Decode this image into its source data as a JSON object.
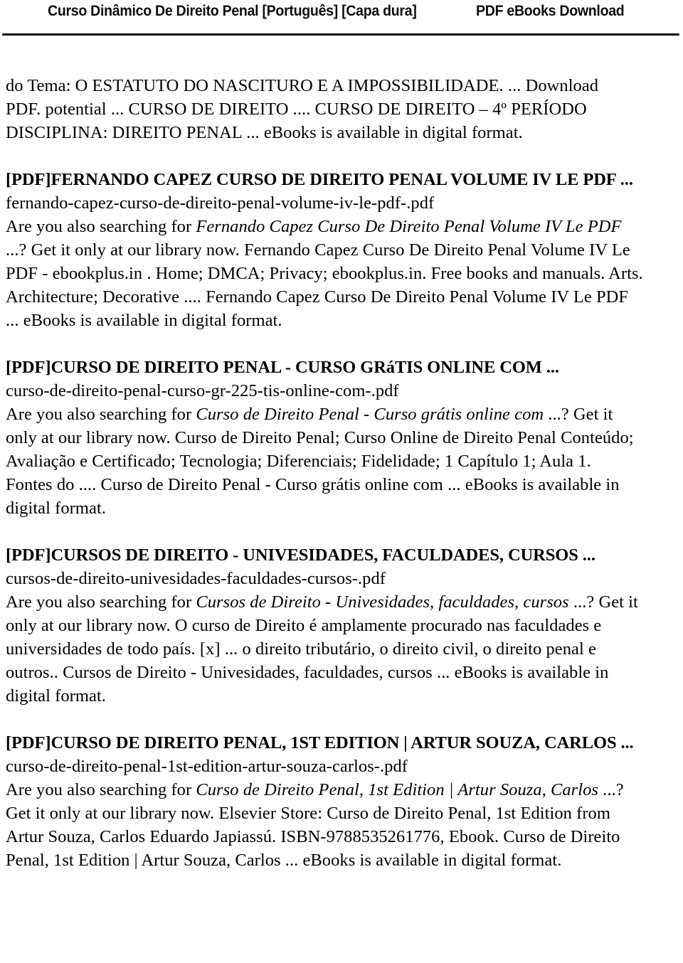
{
  "header": {
    "title": "Curso Dinâmico De Direito Penal [Português]  [Capa dura]",
    "right_label": "PDF eBooks Download"
  },
  "document": {
    "blocks": [
      {
        "name": "intro-paragraph",
        "type": "paragraph",
        "lines": [
          [
            {
              "style": "normal",
              "text": "do Tema: O ESTATUTO DO NASCITURO E A IMPOSSIBILIDADE. ... Download"
            }
          ],
          [
            {
              "style": "normal",
              "text": "PDF. potential ... CURSO DE DIREITO .... CURSO DE DIREITO – 4º PERÍODO"
            }
          ],
          [
            {
              "style": "normal",
              "text": "DISCIPLINA: DIREITO PENAL ... eBooks is available in digital format."
            }
          ]
        ]
      },
      {
        "name": "entry-fernando-capez",
        "type": "entry",
        "heading": "[PDF]FERNANDO CAPEZ CURSO DE DIREITO PENAL VOLUME IV LE PDF ...",
        "filename": "fernando-capez-curso-de-direito-penal-volume-iv-le-pdf-.pdf",
        "lines": [
          [
            {
              "style": "normal",
              "text": "Are you also searching for "
            },
            {
              "style": "italic",
              "text": "Fernando Capez Curso De Direito Penal Volume IV Le PDF"
            }
          ],
          [
            {
              "style": "normal",
              "text": "...? Get it only at our library now. Fernando Capez Curso De Direito Penal Volume IV Le"
            }
          ],
          [
            {
              "style": "normal",
              "text": "PDF - ebookplus.in . Home; DMCA; Privacy; ebookplus.in. Free books and manuals. Arts."
            }
          ],
          [
            {
              "style": "normal",
              "text": "Architecture; Decorative .... Fernando Capez Curso De Direito Penal Volume IV Le PDF"
            }
          ],
          [
            {
              "style": "normal",
              "text": "... eBooks is available in digital format."
            }
          ]
        ]
      },
      {
        "name": "entry-curso-gratis-online",
        "type": "entry",
        "heading": "[PDF]CURSO DE DIREITO PENAL - CURSO GRáTIS ONLINE COM ...",
        "filename": "curso-de-direito-penal-curso-gr-225-tis-online-com-.pdf",
        "lines": [
          [
            {
              "style": "normal",
              "text": "Are you also searching for "
            },
            {
              "style": "italic",
              "text": "Curso de Direito Penal - Curso grátis online com "
            },
            {
              "style": "normal",
              "text": "...? Get it"
            }
          ],
          [
            {
              "style": "normal",
              "text": "only at our library now. Curso de Direito Penal; Curso Online de Direito Penal Conteúdo;"
            }
          ],
          [
            {
              "style": "normal",
              "text": "Avaliação e Certificado; Tecnologia; Diferenciais; Fidelidade; 1 Capítulo 1; Aula 1."
            }
          ],
          [
            {
              "style": "normal",
              "text": "Fontes do .... Curso de Direito Penal - Curso grátis online com ... eBooks is available in"
            }
          ],
          [
            {
              "style": "normal",
              "text": "digital format."
            }
          ]
        ]
      },
      {
        "name": "entry-cursos-univesidades",
        "type": "entry",
        "heading": "[PDF]CURSOS DE DIREITO - UNIVESIDADES, FACULDADES, CURSOS ...",
        "filename": "cursos-de-direito-univesidades-faculdades-cursos-.pdf",
        "lines": [
          [
            {
              "style": "normal",
              "text": "Are you also searching for "
            },
            {
              "style": "italic",
              "text": "Cursos de Direito - Univesidades, faculdades, cursos "
            },
            {
              "style": "normal",
              "text": "...? Get it"
            }
          ],
          [
            {
              "style": "normal",
              "text": "only at our library now. O curso de Direito é amplamente procurado nas faculdades e"
            }
          ],
          [
            {
              "style": "normal",
              "text": "universidades de todo país. [x] ... o direito tributário, o direito civil, o direito penal e"
            }
          ],
          [
            {
              "style": "normal",
              "text": "outros.. Cursos de Direito - Univesidades, faculdades, cursos ... eBooks is available in"
            }
          ],
          [
            {
              "style": "normal",
              "text": "digital format."
            }
          ]
        ]
      },
      {
        "name": "entry-artur-souza-carlos",
        "type": "entry",
        "heading": "[PDF]CURSO DE DIREITO PENAL, 1ST EDITION | ARTUR SOUZA, CARLOS ...",
        "filename": "curso-de-direito-penal-1st-edition-artur-souza-carlos-.pdf",
        "lines": [
          [
            {
              "style": "normal",
              "text": "Are you also searching for "
            },
            {
              "style": "italic",
              "text": "Curso de Direito Penal, 1st Edition | Artur Souza, Carlos "
            },
            {
              "style": "normal",
              "text": "...?"
            }
          ],
          [
            {
              "style": "normal",
              "text": "Get it only at our library now. Elsevier Store: Curso de Direito Penal, 1st Edition from"
            }
          ],
          [
            {
              "style": "normal",
              "text": "Artur Souza, Carlos Eduardo Japiassú. ISBN-9788535261776, Ebook. Curso de Direito"
            }
          ],
          [
            {
              "style": "normal",
              "text": "Penal, 1st Edition | Artur Souza, Carlos ... eBooks is available in digital format."
            }
          ]
        ]
      }
    ]
  }
}
